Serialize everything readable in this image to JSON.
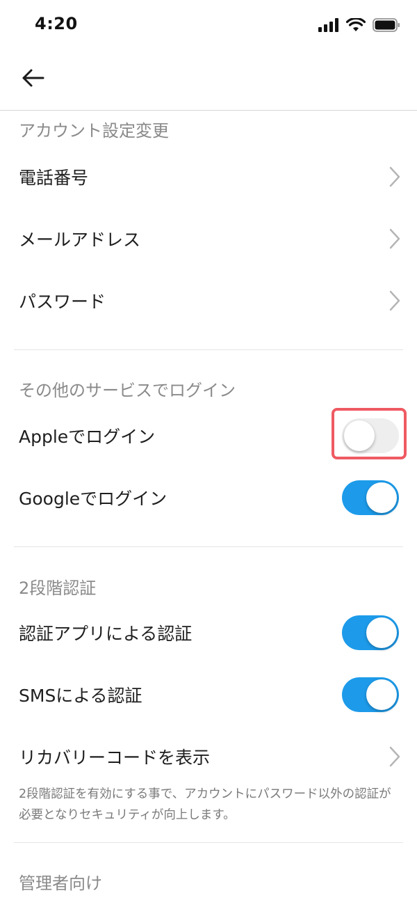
{
  "status_bar": {
    "time": "4:20",
    "icons": [
      "signal-icon",
      "wifi-icon",
      "battery-icon"
    ]
  },
  "nav": {
    "back_icon": "arrow-left-icon"
  },
  "sections": {
    "account": {
      "title": "アカウント設定変更",
      "items": [
        {
          "label": "電話番号"
        },
        {
          "label": "メールアドレス"
        },
        {
          "label": "パスワード"
        }
      ]
    },
    "other_login": {
      "title": "その他のサービスでログイン",
      "items": [
        {
          "label": "Appleでログイン",
          "enabled": false
        },
        {
          "label": "Googleでログイン",
          "enabled": true
        }
      ]
    },
    "two_factor": {
      "title": "2段階認証",
      "items": [
        {
          "label": "認証アプリによる認証",
          "enabled": true
        },
        {
          "label": "SMSによる認証",
          "enabled": true
        },
        {
          "label": "リカバリーコードを表示"
        }
      ],
      "note": "2段階認証を有効にする事で、アカウントにパスワード以外の認証が必要となりセキュリティが向上します。"
    },
    "admin": {
      "title": "管理者向け"
    }
  },
  "colors": {
    "toggle_on": "#1d9bea",
    "toggle_off": "#eeeeee",
    "highlight": "#ef5a62",
    "section_title": "#8a8a8a"
  }
}
